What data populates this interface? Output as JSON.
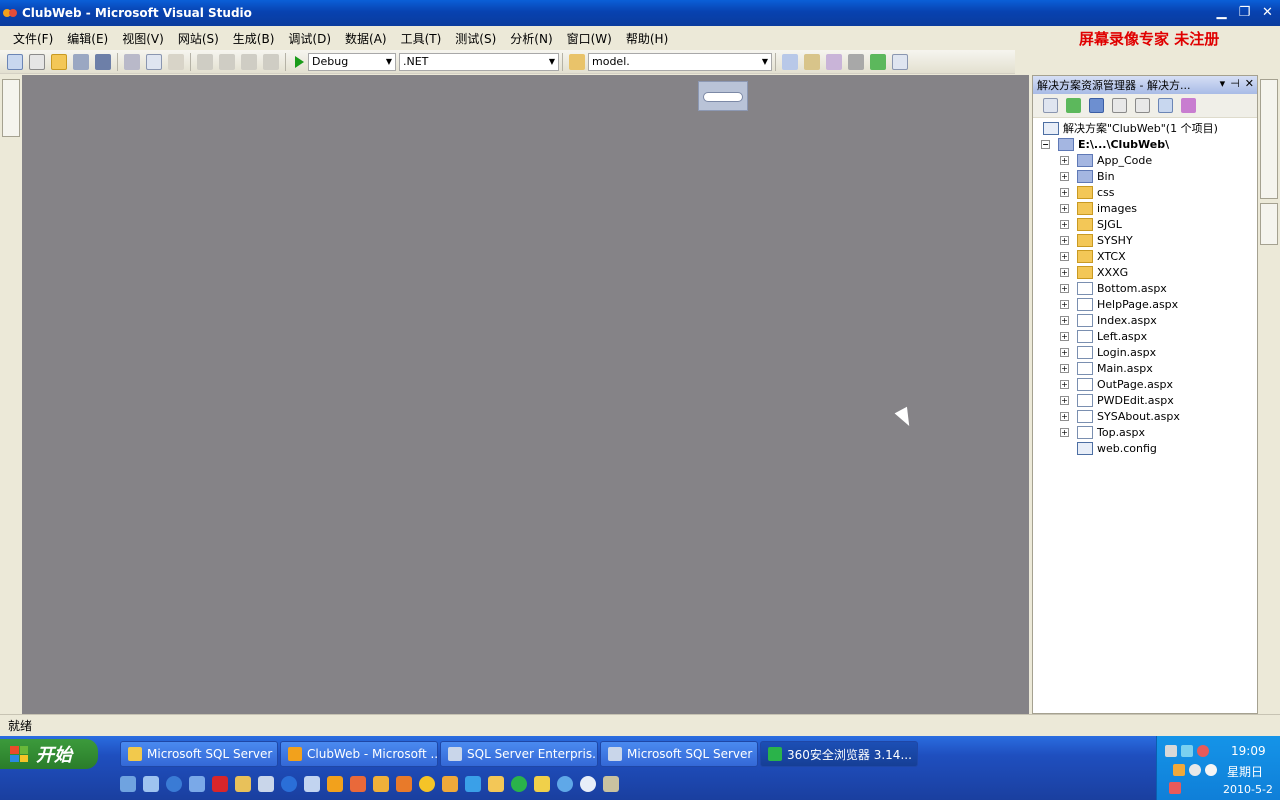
{
  "window": {
    "title": "ClubWeb - Microsoft Visual Studio",
    "controls": {
      "minimize": "▁",
      "restore": "❐",
      "close": "✕"
    }
  },
  "watermark": "屏幕录像专家  未注册",
  "menu": [
    "文件(F)",
    "编辑(E)",
    "视图(V)",
    "网站(S)",
    "生成(B)",
    "调试(D)",
    "数据(A)",
    "工具(T)",
    "测试(S)",
    "分析(N)",
    "窗口(W)",
    "帮助(H)"
  ],
  "toolbar": {
    "config": "Debug",
    "platform": ".NET",
    "find": "model."
  },
  "solution_explorer": {
    "title": "解决方案资源管理器 - 解决方...",
    "root": "解决方案\"ClubWeb\"(1 个项目)",
    "project": "E:\\...\\ClubWeb\\",
    "items": [
      {
        "name": "App_Code",
        "kind": "special"
      },
      {
        "name": "Bin",
        "kind": "special"
      },
      {
        "name": "css",
        "kind": "folder"
      },
      {
        "name": "images",
        "kind": "folder"
      },
      {
        "name": "SJGL",
        "kind": "folder"
      },
      {
        "name": "SYSHY",
        "kind": "folder"
      },
      {
        "name": "XTCX",
        "kind": "folder"
      },
      {
        "name": "XXXG",
        "kind": "folder"
      },
      {
        "name": "Bottom.aspx",
        "kind": "page"
      },
      {
        "name": "HelpPage.aspx",
        "kind": "page"
      },
      {
        "name": "Index.aspx",
        "kind": "page"
      },
      {
        "name": "Left.aspx",
        "kind": "page"
      },
      {
        "name": "Login.aspx",
        "kind": "page"
      },
      {
        "name": "Main.aspx",
        "kind": "page"
      },
      {
        "name": "OutPage.aspx",
        "kind": "page"
      },
      {
        "name": "PWDEdit.aspx",
        "kind": "page"
      },
      {
        "name": "SYSAbout.aspx",
        "kind": "page"
      },
      {
        "name": "Top.aspx",
        "kind": "page"
      },
      {
        "name": "web.config",
        "kind": "config"
      }
    ]
  },
  "status": "就绪",
  "taskbar": {
    "start": "开始",
    "tasks": [
      {
        "label": "Microsoft SQL Server",
        "color": "#f2c94c"
      },
      {
        "label": "ClubWeb - Microsoft ...",
        "color": "#f2a11c"
      },
      {
        "label": "SQL Server Enterpris...",
        "color": "#c9d6ea"
      },
      {
        "label": "Microsoft SQL Server ...",
        "color": "#c9d6ea"
      },
      {
        "label": "360安全浏览器 3.14...",
        "color": "#2ab34a"
      }
    ],
    "time": "19:09",
    "weekday": "星期日",
    "date": "2010-5-2"
  }
}
